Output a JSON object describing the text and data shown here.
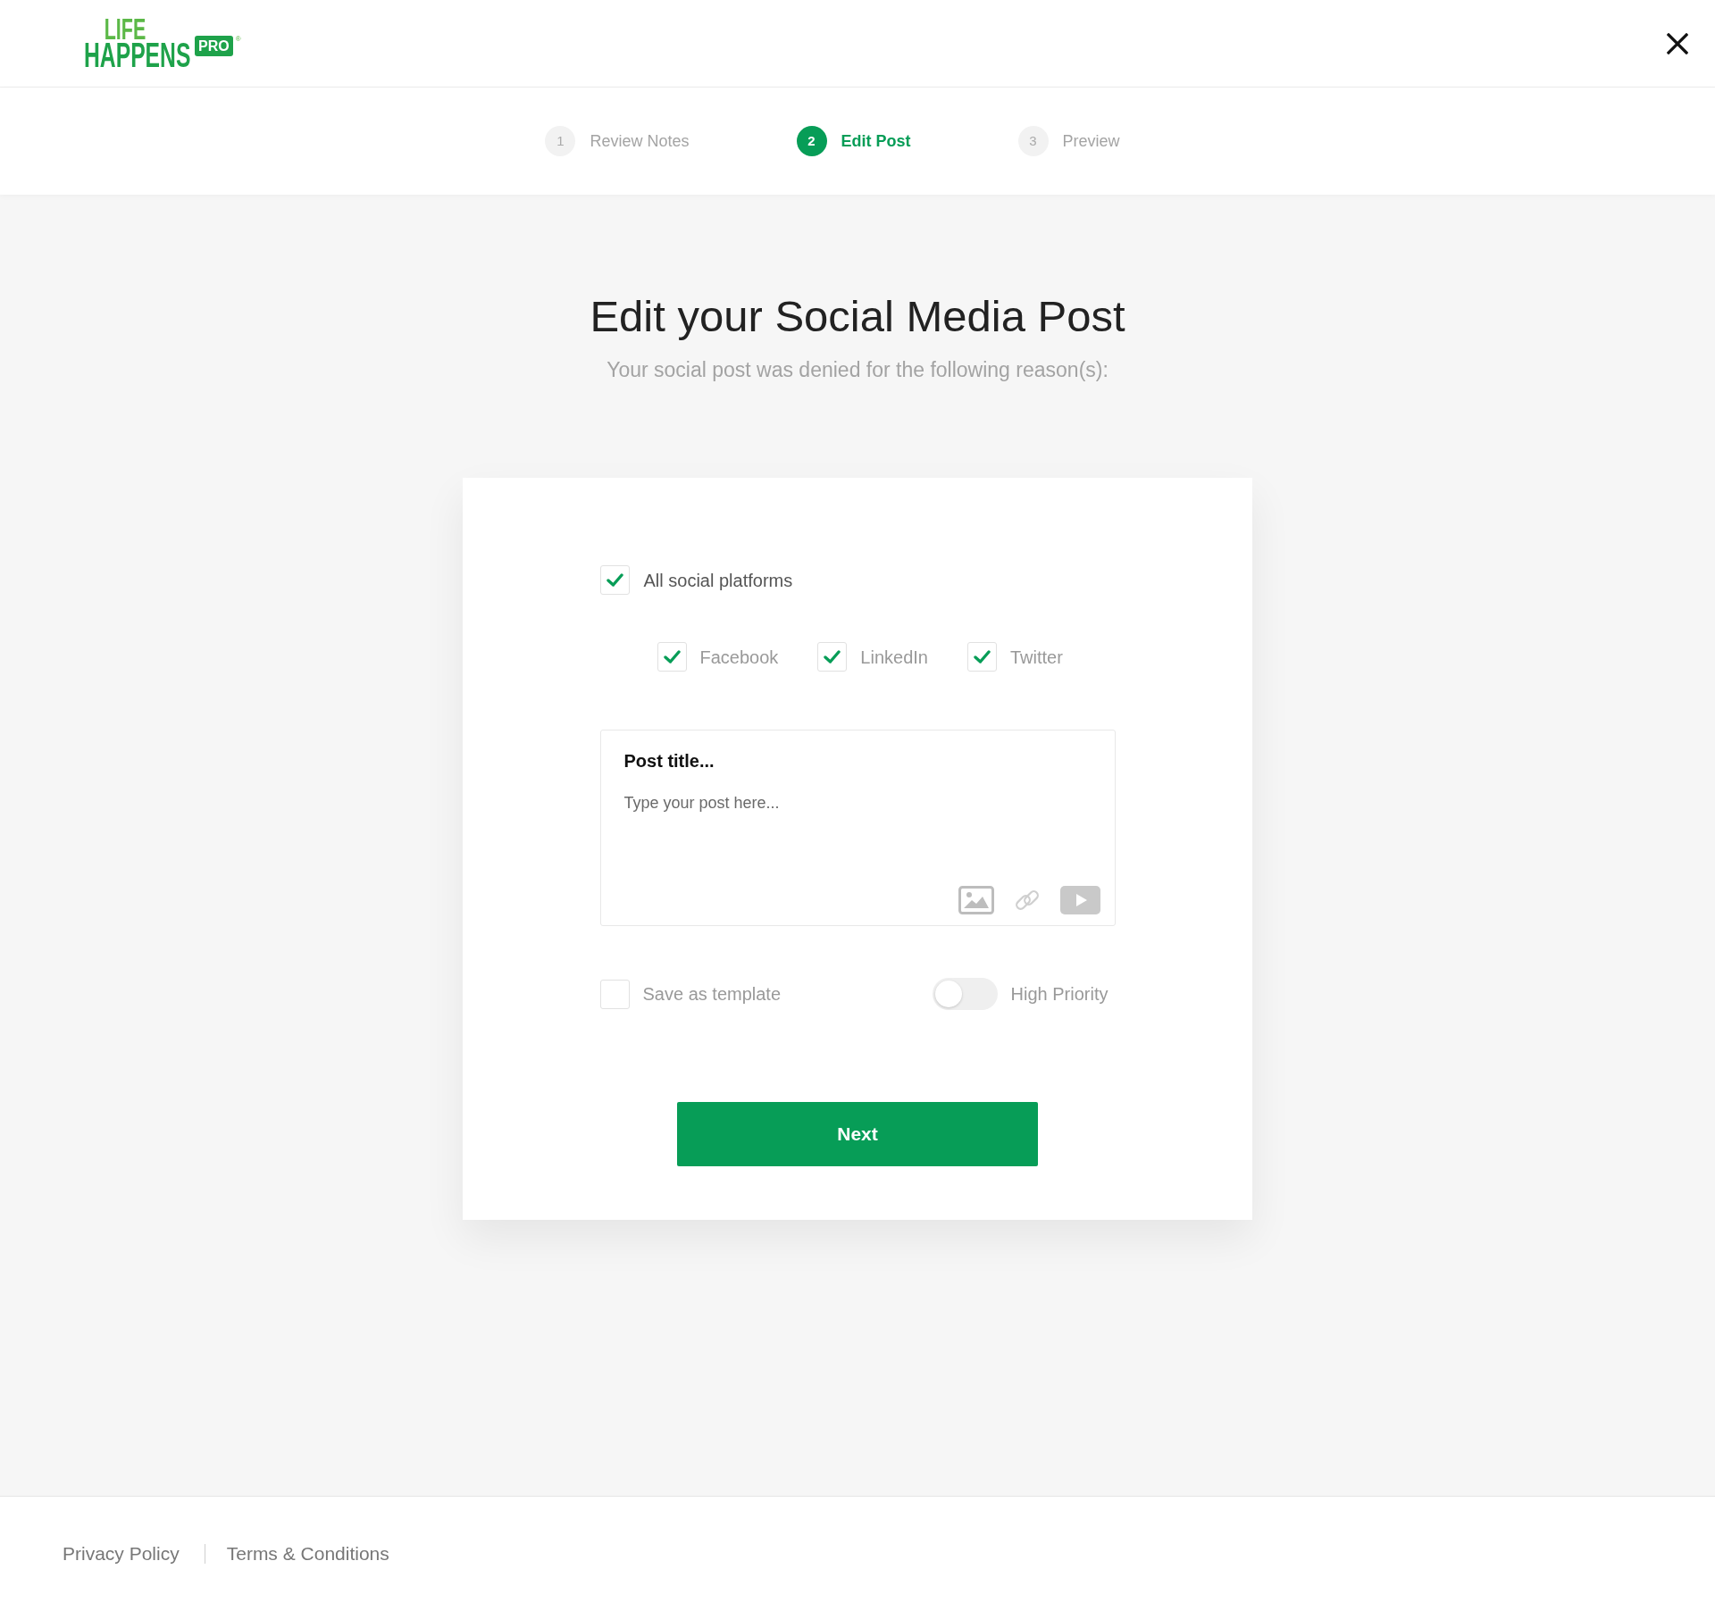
{
  "logo": {
    "lines": [
      "LIFE",
      "HAPPENS"
    ],
    "badge": "PRO",
    "mark": "®"
  },
  "steps": [
    {
      "number": "1",
      "label": "Review Notes",
      "selected": false
    },
    {
      "number": "2",
      "label": "Edit Post",
      "selected": true
    },
    {
      "number": "3",
      "label": "Preview",
      "selected": false
    }
  ],
  "heading": "Edit your Social Media Post",
  "subheading": "Your social post was denied for the following reason(s):",
  "form": {
    "all_platforms": {
      "label": "All social platforms",
      "checked": true
    },
    "platforms": [
      {
        "label": "Facebook",
        "checked": true
      },
      {
        "label": "LinkedIn",
        "checked": true
      },
      {
        "label": "Twitter",
        "checked": true
      }
    ],
    "post": {
      "title": {
        "placeholder": "Post title..."
      },
      "body": {
        "placeholder": "Type your post here..."
      }
    },
    "save_template": {
      "label": "Save as template",
      "checked": false
    },
    "high_priority": {
      "label": "High Priority",
      "on": false
    },
    "next_button": "Next"
  },
  "footer": {
    "links": [
      "Privacy Policy",
      "Terms & Conditions"
    ]
  }
}
